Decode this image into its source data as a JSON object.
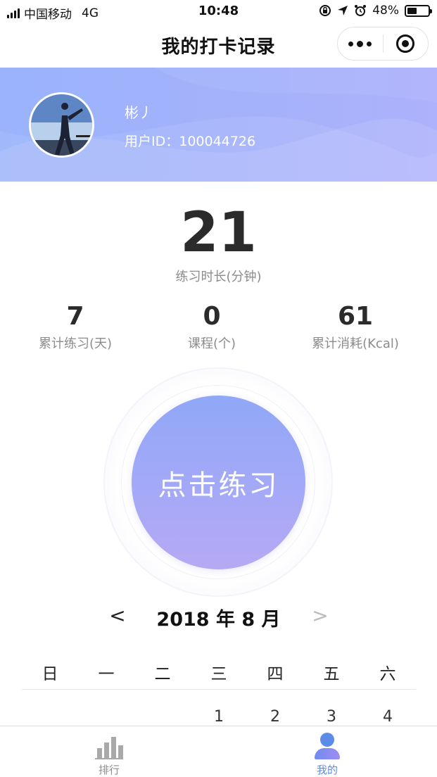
{
  "status_bar": {
    "carrier": "中国移动",
    "network": "4G",
    "time": "10:48",
    "battery_percent": "48%",
    "battery_level": 0.48
  },
  "nav": {
    "title": "我的打卡记录"
  },
  "profile": {
    "username": "彬丿",
    "user_id": "用户ID：100044726"
  },
  "stats": {
    "main_value": "21",
    "main_label": "练习时长(分钟)",
    "items": [
      {
        "value": "7",
        "label": "累计练习(天)"
      },
      {
        "value": "0",
        "label": "课程(个)"
      },
      {
        "value": "61",
        "label": "累计消耗(Kcal)"
      }
    ]
  },
  "practice_button": {
    "label": "点击练习"
  },
  "calendar": {
    "prev": "<",
    "title": "2018 年 8 月",
    "next": ">",
    "weekdays": [
      "日",
      "一",
      "二",
      "三",
      "四",
      "五",
      "六"
    ],
    "first_week": [
      "",
      "",
      "",
      "1",
      "2",
      "3",
      "4"
    ]
  },
  "tabs": [
    {
      "label": "排行",
      "icon": "bar-chart-icon",
      "active": false,
      "color": "#8c8c8c"
    },
    {
      "label": "我的",
      "icon": "person-icon",
      "active": true,
      "color": "#5b8ce8"
    }
  ]
}
